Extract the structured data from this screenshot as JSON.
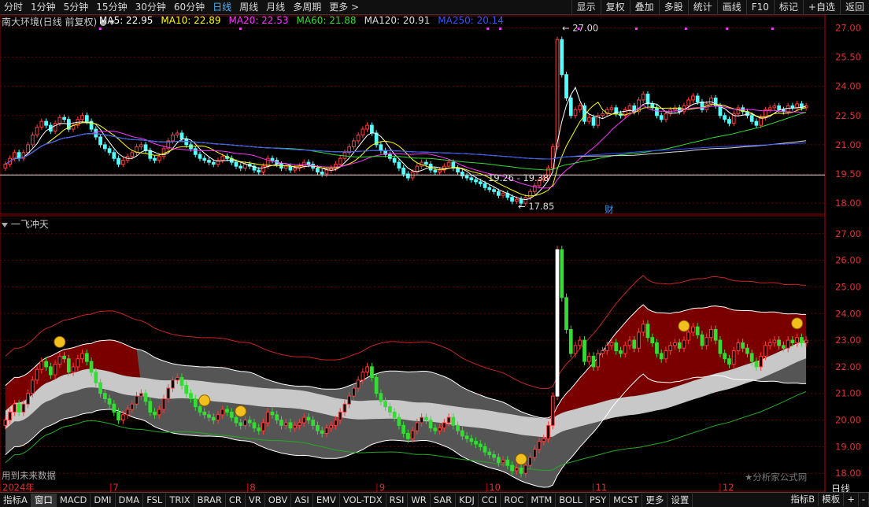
{
  "timeframes": [
    {
      "label": "分时",
      "active": false
    },
    {
      "label": "1分钟",
      "active": false
    },
    {
      "label": "5分钟",
      "active": false
    },
    {
      "label": "15分钟",
      "active": false
    },
    {
      "label": "30分钟",
      "active": false
    },
    {
      "label": "60分钟",
      "active": false
    },
    {
      "label": "日线",
      "active": true
    },
    {
      "label": "周线",
      "active": false
    },
    {
      "label": "月线",
      "active": false
    },
    {
      "label": "多周期",
      "active": false
    },
    {
      "label": "更多 >",
      "active": false
    }
  ],
  "top_right_buttons": [
    "显示",
    "复权",
    "叠加",
    "多股",
    "统计",
    "画线",
    "F10",
    "标记",
    "+自选",
    "返回"
  ],
  "stock_title": "南大环境(日线 前复权)",
  "ma_legend": [
    {
      "text": "MA5: 22.95",
      "color": "#ffffff"
    },
    {
      "text": "MA10: 22.89",
      "color": "#ffff00"
    },
    {
      "text": "MA20: 22.53",
      "color": "#ff33ff"
    },
    {
      "text": "MA60: 21.88",
      "color": "#33dd33"
    },
    {
      "text": "MA120: 20.91",
      "color": "#dddddd"
    },
    {
      "text": "MA250: 20.14",
      "color": "#3355ff"
    }
  ],
  "sub_indicator_title": "一飞冲天",
  "main_axis_labels": [
    "27.00",
    "25.50",
    "24.00",
    "22.50",
    "21.00",
    "19.50",
    "18.00"
  ],
  "sub_axis_labels": [
    "27.00",
    "26.00",
    "25.00",
    "24.00",
    "23.00",
    "22.00",
    "21.00",
    "20.00",
    "19.00",
    "18.00"
  ],
  "annotations": {
    "high": "27.00",
    "low": "17.85",
    "range": "19.26 - 19.38",
    "finance_mark": "财"
  },
  "x_axis_labels": [
    {
      "label": "2024年",
      "pos": 0.0
    },
    {
      "label": "7",
      "pos": 0.134
    },
    {
      "label": "8",
      "pos": 0.3
    },
    {
      "label": "9",
      "pos": 0.457
    },
    {
      "label": "10",
      "pos": 0.59
    },
    {
      "label": "11",
      "pos": 0.719
    },
    {
      "label": "12",
      "pos": 0.873
    }
  ],
  "note_text": "用到未来数据",
  "brand_text": "★分析家公式网",
  "bottom_tabs": [
    "指标A",
    "窗口",
    "MACD",
    "DMI",
    "DMA",
    "FSL",
    "TRIX",
    "BRAR",
    "CR",
    "VR",
    "OBV",
    "ASI",
    "EMV",
    "VOL-TDX",
    "RSI",
    "WR",
    "SAR",
    "KDJ",
    "CCI",
    "ROC",
    "MTM",
    "BOLL",
    "PSY",
    "MCST",
    "更多",
    "设置"
  ],
  "bottom_right_tabs": [
    "指标B",
    "模板",
    "+",
    "-"
  ],
  "daily_label": "日线",
  "colors": {
    "up": "#ff3b3b",
    "down": "#55ffff",
    "grid": "#7a0000",
    "axis": "#e03030"
  },
  "chart_data": {
    "type": "candlestick",
    "price_range_main": [
      17.6,
      27.3
    ],
    "price_range_sub": [
      17.8,
      27.2
    ],
    "closes": [
      20.0,
      20.3,
      20.6,
      20.3,
      20.6,
      21.0,
      21.5,
      21.9,
      22.2,
      22.0,
      21.7,
      22.1,
      22.4,
      22.3,
      21.8,
      22.0,
      22.3,
      22.5,
      22.2,
      21.8,
      21.4,
      21.0,
      20.8,
      20.6,
      20.3,
      20.0,
      20.2,
      20.4,
      20.6,
      20.9,
      21.0,
      20.7,
      20.3,
      20.2,
      20.4,
      20.8,
      21.2,
      21.5,
      21.6,
      21.3,
      21.0,
      20.8,
      20.5,
      20.3,
      20.2,
      20.1,
      20.0,
      20.2,
      20.4,
      20.3,
      20.1,
      19.9,
      19.8,
      20.0,
      19.9,
      19.7,
      19.6,
      19.9,
      20.3,
      20.2,
      20.0,
      19.8,
      19.9,
      19.7,
      19.8,
      19.9,
      20.1,
      20.0,
      19.8,
      19.6,
      19.5,
      19.7,
      19.8,
      20.0,
      20.3,
      20.6,
      20.9,
      21.2,
      21.5,
      21.8,
      22.0,
      21.6,
      21.0,
      20.7,
      20.5,
      20.3,
      20.1,
      19.8,
      19.5,
      19.3,
      19.6,
      19.9,
      20.1,
      20.0,
      19.7,
      19.6,
      19.7,
      19.9,
      20.1,
      19.8,
      19.6,
      19.4,
      19.3,
      19.2,
      19.1,
      19.0,
      18.8,
      18.7,
      18.6,
      18.4,
      18.5,
      18.3,
      18.1,
      18.2,
      18.0,
      18.3,
      18.6,
      18.9,
      19.2,
      19.3,
      19.8,
      20.9,
      26.4,
      24.6,
      23.4,
      22.5,
      22.8,
      23.0,
      22.2,
      22.4,
      22.0,
      22.5,
      22.6,
      22.8,
      22.9,
      22.6,
      22.5,
      22.8,
      23.0,
      22.7,
      23.3,
      23.6,
      23.1,
      22.9,
      22.5,
      22.3,
      22.6,
      22.8,
      22.9,
      22.7,
      23.0,
      23.3,
      23.5,
      23.2,
      22.8,
      23.1,
      23.4,
      23.0,
      22.5,
      22.3,
      22.1,
      22.6,
      22.9,
      22.7,
      22.5,
      22.2,
      22.0,
      22.4,
      22.8,
      22.9,
      23.0,
      22.8,
      22.7,
      23.0,
      22.9,
      23.1,
      22.9,
      23.0
    ]
  }
}
